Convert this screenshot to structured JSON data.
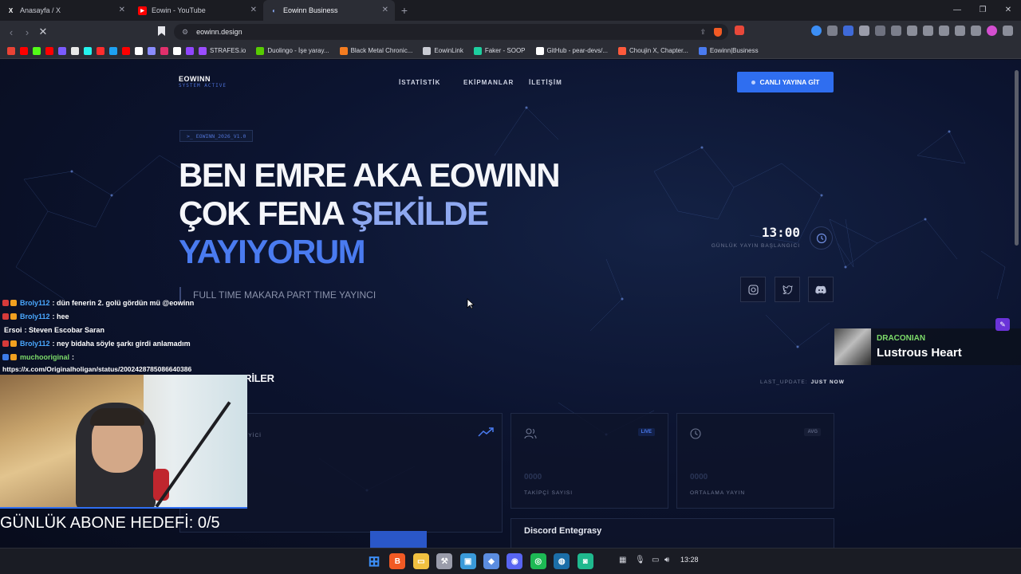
{
  "browser": {
    "tabs": [
      {
        "title": "Anasayfa / X",
        "icon": "x-logo-icon",
        "icon_text": "X",
        "icon_color": "#ffffff",
        "icon_bg": "transparent"
      },
      {
        "title": "Eowin - YouTube",
        "icon": "youtube-icon",
        "icon_text": "▶",
        "icon_color": "#ffffff",
        "icon_bg": "#ff0000"
      },
      {
        "title": "Eowinn Business",
        "icon": "site-icon",
        "icon_text": "◐",
        "icon_color": "#8fb0ff",
        "icon_bg": "transparent"
      }
    ],
    "address": "eowinn.design",
    "bookmarks": [
      {
        "label": "STRAFES.io",
        "color": "#9b4dff"
      },
      {
        "label": "Duolingo - İşe yaray...",
        "color": "#58cc02"
      },
      {
        "label": "Black Metal Chronic...",
        "color": "#f47c20"
      },
      {
        "label": "EowinLink",
        "color": "#c9cbd3"
      },
      {
        "label": "Faker - SOOP",
        "color": "#1dcf9f"
      },
      {
        "label": "GitHub - pear-devs/...",
        "color": "#ffffff"
      },
      {
        "label": "Choujin X, Chapter...",
        "color": "#ff5a3c"
      },
      {
        "label": "Eowinn|Business",
        "color": "#4a7bf0"
      }
    ],
    "bookmark_icon_colors": [
      "#ea4335",
      "#ff0000",
      "#53fc18",
      "#ff0000",
      "#7b5bff",
      "#e8e8e8",
      "#25f4ee",
      "#ff2d2d",
      "#1da1f2",
      "#ff0000",
      "#ffffff",
      "#8a8cff",
      "#e1306c",
      "#ffffff",
      "#9146ff"
    ]
  },
  "site": {
    "logo_name": "EOWINN",
    "logo_sub": "SYSTEM ACTIVE",
    "nav": [
      "İSTATİSTİK",
      "EKİPMANLAR",
      "İLETİŞİM"
    ],
    "cta": "CANLI YAYINA GİT",
    "version": ">_  EOWINN_2026_V1.0",
    "headline_1": "BEN EMRE AKA EOWINN",
    "headline_2a": "ÇOK FENA ",
    "headline_2b": "ŞEKİLDE",
    "headline_3": "YAYIYORUM",
    "subline": "FULL TIME MAKARA PART TIME YAYINCI",
    "clock_time": "13:00",
    "clock_caption": "GÜNLÜK YAYIN BAŞLANGICI",
    "section_title": "CANLI VERİLER",
    "last_update_label": "LAST_UPDATE:",
    "last_update_value": "JUST NOW",
    "card1_caption": "EYİCİ",
    "card1_value": "0",
    "card2_tag": "LIVE",
    "card2_caption": "TAKİPÇİ SAYISI",
    "card2_value": "0000",
    "card3_tag": "AVG",
    "card3_caption": "ORTALAMA YAYIN",
    "card3_value": "0000",
    "card4_title": "Discord Entegrasy"
  },
  "stream": {
    "chat": [
      {
        "user": "Broly112",
        "message": ": dün fenerin 2. golü gördün mü @eowinn",
        "color": "#4aa8ff",
        "badges": [
          "#d63a3a",
          "#f0a020"
        ]
      },
      {
        "user": "Broly112",
        "message": ": hee",
        "color": "#4aa8ff",
        "badges": [
          "#d63a3a",
          "#f0a020"
        ]
      },
      {
        "user": "Ersoi",
        "message": ": Steven Escobar Saran",
        "color": "#ffffff",
        "badges": []
      },
      {
        "user": "Broly112",
        "message": ": ney bidaha söyle şarkı girdi anlamadım",
        "color": "#4aa8ff",
        "badges": [
          "#d63a3a",
          "#f0a020"
        ]
      },
      {
        "user": "muchooriginal",
        "message": ":",
        "color": "#7ddc6a",
        "badges": [
          "#3c7be8",
          "#f0a020"
        ]
      }
    ],
    "chat_url": "https://x.com/Originalholigan/status/2002428785086640386",
    "goal": "GÜNLÜK ABONE HEDEFİ: 0/5",
    "now_playing_artist": "DRACONIAN",
    "now_playing_song": "Lustrous Heart"
  },
  "taskbar": {
    "apps": [
      {
        "name": "windows-start-icon",
        "color": "#3c8ef5",
        "glyph": "⊞"
      },
      {
        "name": "brave-browser-icon",
        "color": "#f15a24",
        "glyph": "B"
      },
      {
        "name": "file-explorer-icon",
        "color": "#f0c040",
        "glyph": "▭"
      },
      {
        "name": "hammer-tool-icon",
        "color": "#9a9caa",
        "glyph": "⚒"
      },
      {
        "name": "photos-icon",
        "color": "#3a9ad9",
        "glyph": "▣"
      },
      {
        "name": "app-grid-icon",
        "color": "#5b8de0",
        "glyph": "◆"
      },
      {
        "name": "discord-icon",
        "color": "#5865f2",
        "glyph": "◉"
      },
      {
        "name": "spotify-icon",
        "color": "#1db954",
        "glyph": "◎"
      },
      {
        "name": "steam-icon",
        "color": "#1b6ea8",
        "glyph": "◍"
      },
      {
        "name": "chat-app-icon",
        "color": "#1fb98e",
        "glyph": "◙"
      }
    ],
    "time": "13:28"
  }
}
